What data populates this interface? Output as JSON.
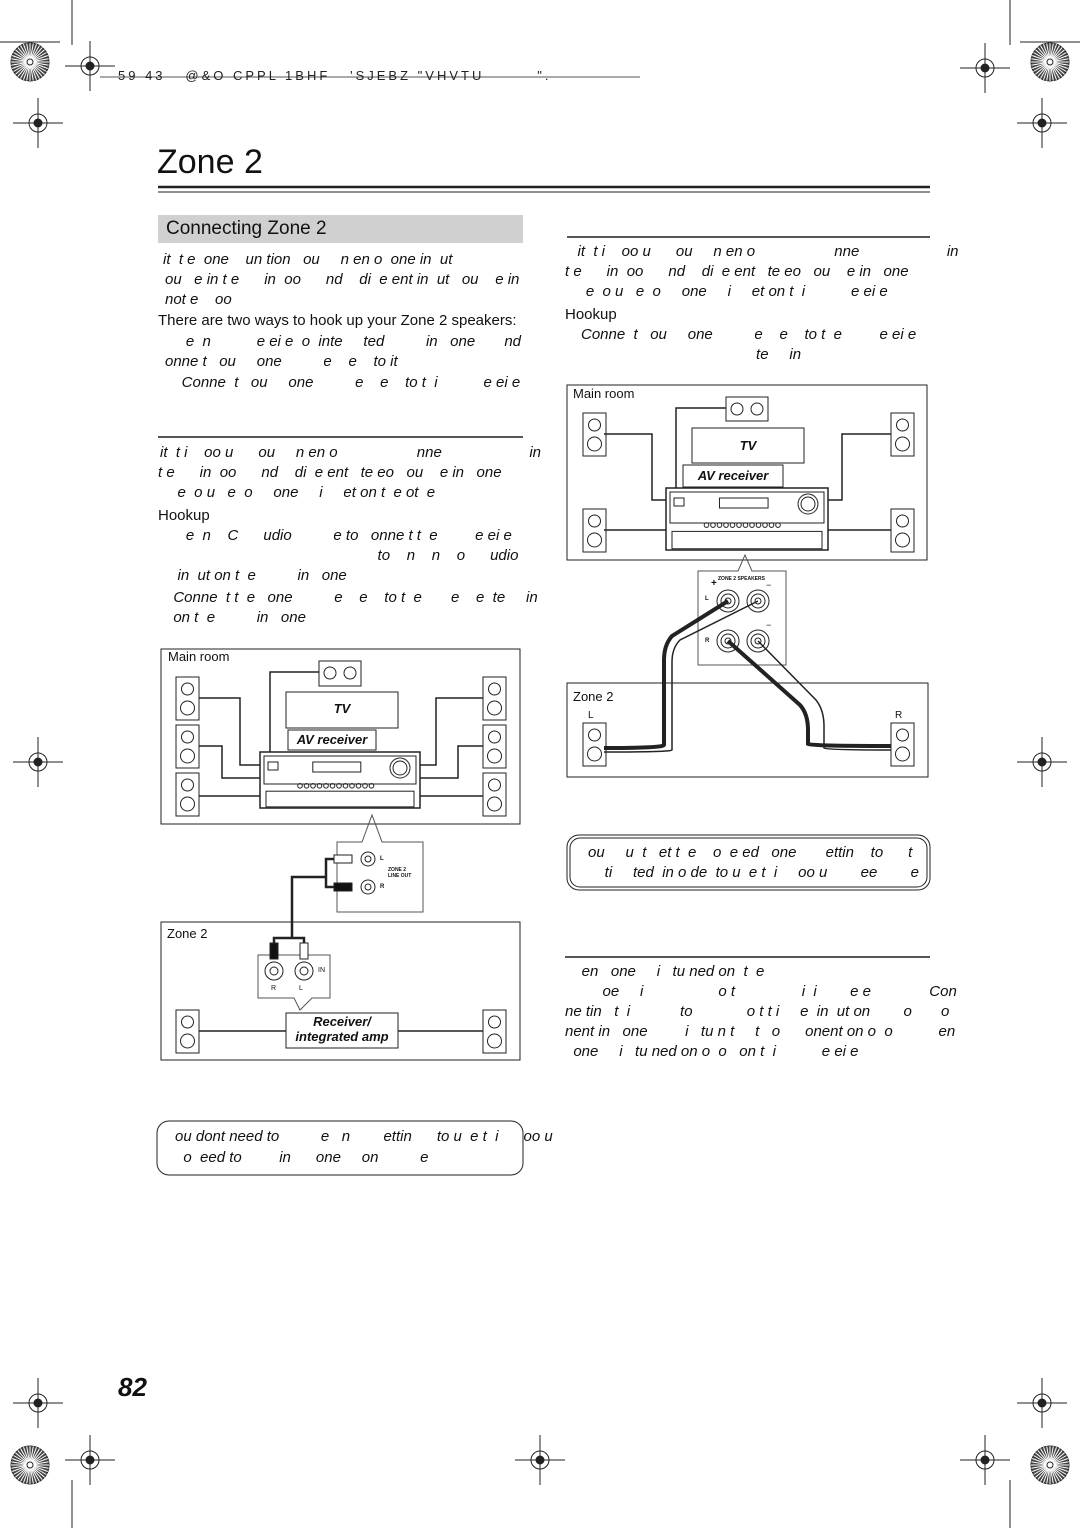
{
  "header": {
    "print_line": "59 43   @&O CPPL 1BHF   'SJEBZ \"VHVTU        \"."
  },
  "page_title": "Zone 2",
  "section_title": "Connecting Zone 2",
  "left_column": {
    "intro": [
      "it  t e  one    un tion   ou     n en o  one in  ut",
      "ou   e in t e      in  oo      nd    di  e ent in  ut   ou    e in",
      "not e    oo"
    ],
    "ways_line": "There are two ways to hook up your Zone 2 speakers:",
    "ways": [
      "     e  n           e ei e  o  inte     ted          in   one       nd",
      "onne t   ou     one          e    e    to it",
      "    Conne  t   ou     one          e    e    to t  i           e ei e"
    ],
    "subsection": [
      "it  t i    oo u      ou     n en o                   nne                     in",
      "t e      in  oo      nd    di  e ent   te eo   ou    e in   one",
      "   e  o u   e  o     one     i     et on t  e ot  e"
    ],
    "hookup_label": "Hookup",
    "hookup": [
      "     e  n    C      udio          e to   onne t t  e         e ei e",
      "                                                   to    n    n    o      udio",
      "   in  ut on t  e          in   one",
      "  Conne  t t  e   one          e    e    to t  e       e    e  te     in",
      "  on t  e          in   one"
    ]
  },
  "right_column": {
    "subsection": [
      "   it  t i    oo u      ou     n en o                   nne                     in",
      "t e      in  oo      nd    di  e ent   te eo   ou    e in   one",
      "     e  o u   e  o     one     i     et on t  i           e ei e"
    ],
    "hookup_label": "Hookup",
    "hookup": [
      "Conne  t   ou     one          e    e    to t  e         e ei e",
      "                                          te     in"
    ],
    "callout": [
      "ou     u  t   et t  e    o  e ed   one       ettin    to      t",
      "    ti     ted  in o de  to u  e t  i     oo u        ee        e"
    ],
    "final": [
      "    en   one     i   tu ned on  t  e",
      "         oe     i                  o t                i  i        e e              Con",
      "ne tin   t  i            to             o t t i     e  in  ut on        o       o",
      "nent in   one         i   tu n t     t   o      onent on o  o           en",
      "  one     i   tu ned on o  o   on t  i           e ei e"
    ]
  },
  "left_note": [
    "ou dont need to          e   n        ettin      to u  e t  i      oo u",
    "  o  eed to         in      one     on          e"
  ],
  "diagrams": {
    "main_room": "Main room",
    "zone2": "Zone 2",
    "tv": "TV",
    "av_receiver": "AV receiver",
    "receiver_amp_1": "Receiver/",
    "receiver_amp_2": "integrated amp",
    "zone2_speakers": "ZONE 2 SPEAKERS",
    "zone2_line_out_1": "ZONE 2",
    "zone2_line_out_2": "LINE OUT",
    "jack_l": "L",
    "jack_r": "R",
    "jack_in": "IN",
    "plus": "+",
    "minus": "−",
    "speaker_l": "L",
    "speaker_r": "R"
  },
  "page_number": "82"
}
